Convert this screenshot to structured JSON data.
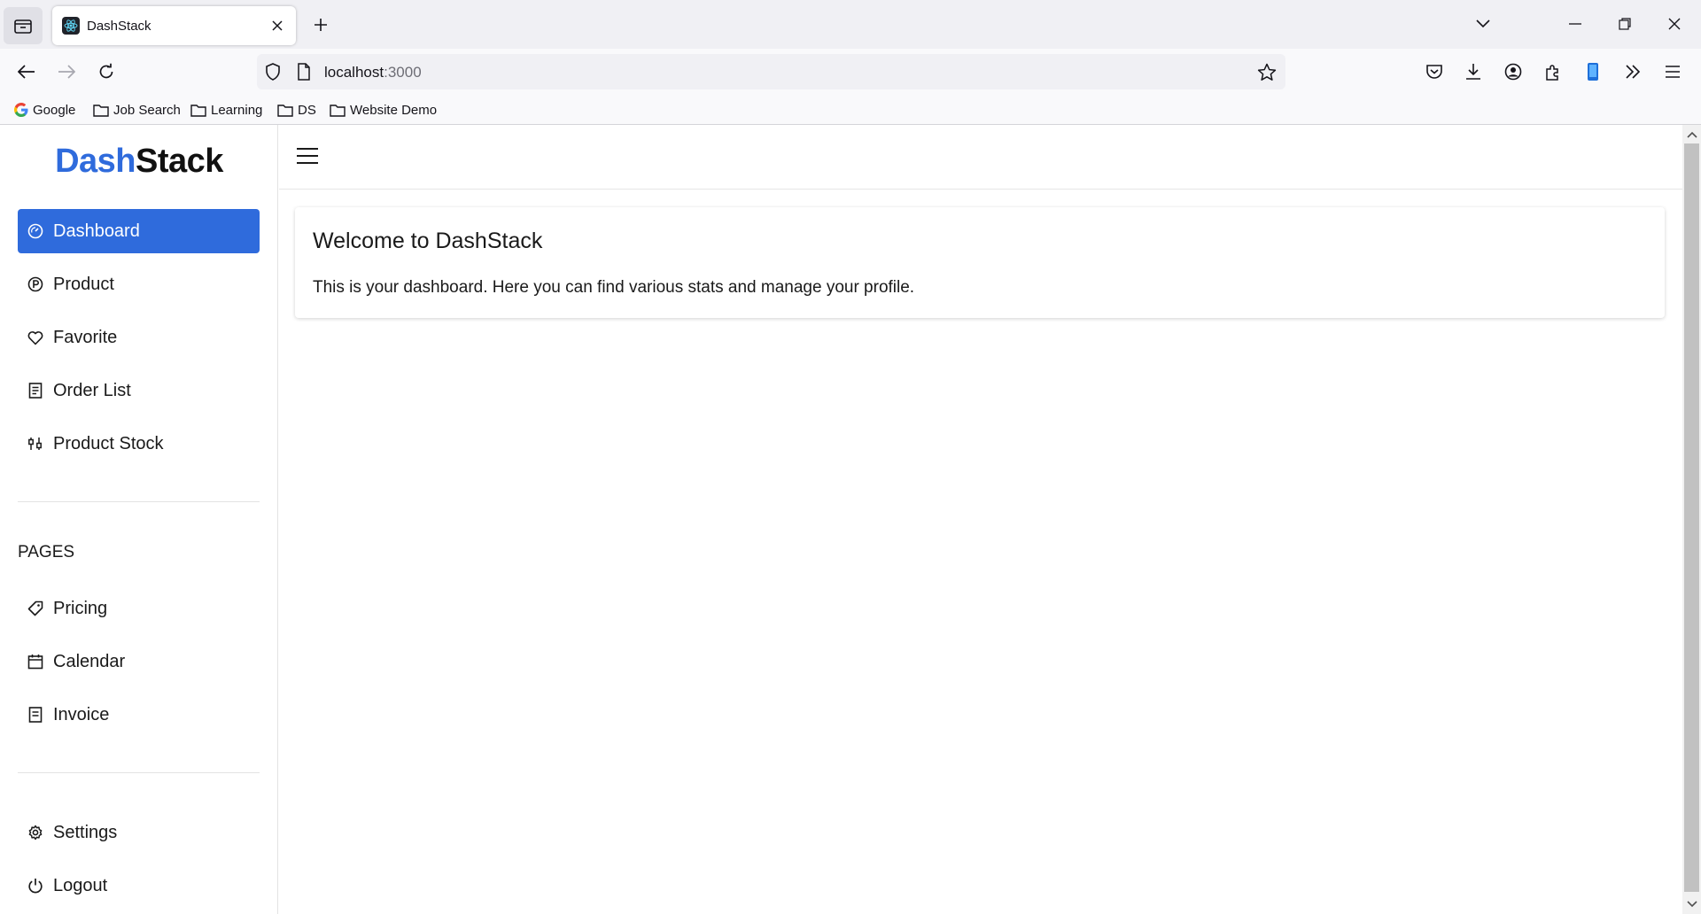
{
  "browser": {
    "tab_title": "DashStack",
    "url_host": "localhost",
    "url_port": ":3000",
    "bookmarks": [
      {
        "label": "Google",
        "icon": "google-icon"
      },
      {
        "label": "Job Search",
        "icon": "folder-icon"
      },
      {
        "label": "Learning",
        "icon": "folder-icon"
      },
      {
        "label": "DS",
        "icon": "folder-icon"
      },
      {
        "label": "Website Demo",
        "icon": "folder-icon"
      }
    ]
  },
  "app": {
    "logo_part1": "Dash",
    "logo_part2": "Stack",
    "brand_color": "#2f6bdc",
    "nav_main": [
      {
        "label": "Dashboard",
        "icon": "dashboard-gauge-icon",
        "active": true
      },
      {
        "label": "Product",
        "icon": "product-icon"
      },
      {
        "label": "Favorite",
        "icon": "heart-icon"
      },
      {
        "label": "Order List",
        "icon": "order-list-icon"
      },
      {
        "label": "Product Stock",
        "icon": "stock-sliders-icon"
      }
    ],
    "pages_label": "PAGES",
    "nav_pages": [
      {
        "label": "Pricing",
        "icon": "tag-icon"
      },
      {
        "label": "Calendar",
        "icon": "calendar-icon"
      },
      {
        "label": "Invoice",
        "icon": "invoice-icon"
      }
    ],
    "nav_bottom": [
      {
        "label": "Settings",
        "icon": "gear-icon"
      },
      {
        "label": "Logout",
        "icon": "power-icon"
      }
    ],
    "card": {
      "title": "Welcome to DashStack",
      "text": "This is your dashboard. Here you can find various stats and manage your profile."
    }
  }
}
